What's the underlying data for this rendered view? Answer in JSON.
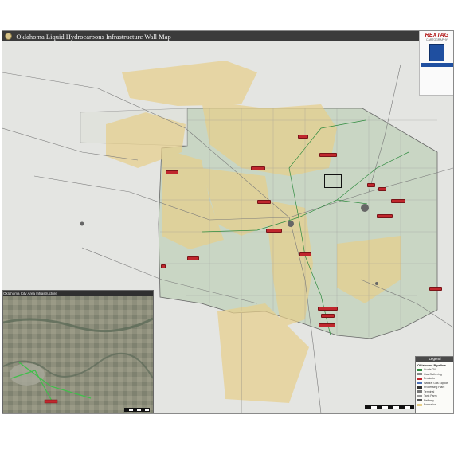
{
  "map": {
    "title": "Oklahoma Liquid Hydrocarbons Infrastructure Wall Map",
    "accent_color": "#c0272d",
    "pipeline_color": "#2e8b3e",
    "county_line_color": "#9a9a9a",
    "formation_fill_color": "#e7cf8a",
    "state_fill_color": "#c9d6c4"
  },
  "logo": {
    "brand": "REXTAG",
    "subtitle": "CARTOGRAPHY",
    "date_badge": ""
  },
  "inset": {
    "title": "Oklahoma City Area Infrastructure"
  },
  "legend": {
    "header": "Legend",
    "subtitle": "Oklahoma Pipeline",
    "rows": [
      {
        "label": "Crude Oil",
        "color": "#2e8b3e"
      },
      {
        "label": "Gas Gathering",
        "color": "#8a8a8a"
      },
      {
        "label": "Products",
        "color": "#c0272d"
      },
      {
        "label": "Natural Gas Liquids",
        "color": "#4a6fb5"
      },
      {
        "label": "Processing Plant",
        "color": "#333333"
      },
      {
        "label": "Terminal",
        "color": "#777777"
      },
      {
        "label": "Tank Farm",
        "color": "#999999"
      },
      {
        "label": "Refinery",
        "color": "#555555"
      },
      {
        "label": "Formation",
        "color": "#e7cf8a"
      }
    ]
  }
}
